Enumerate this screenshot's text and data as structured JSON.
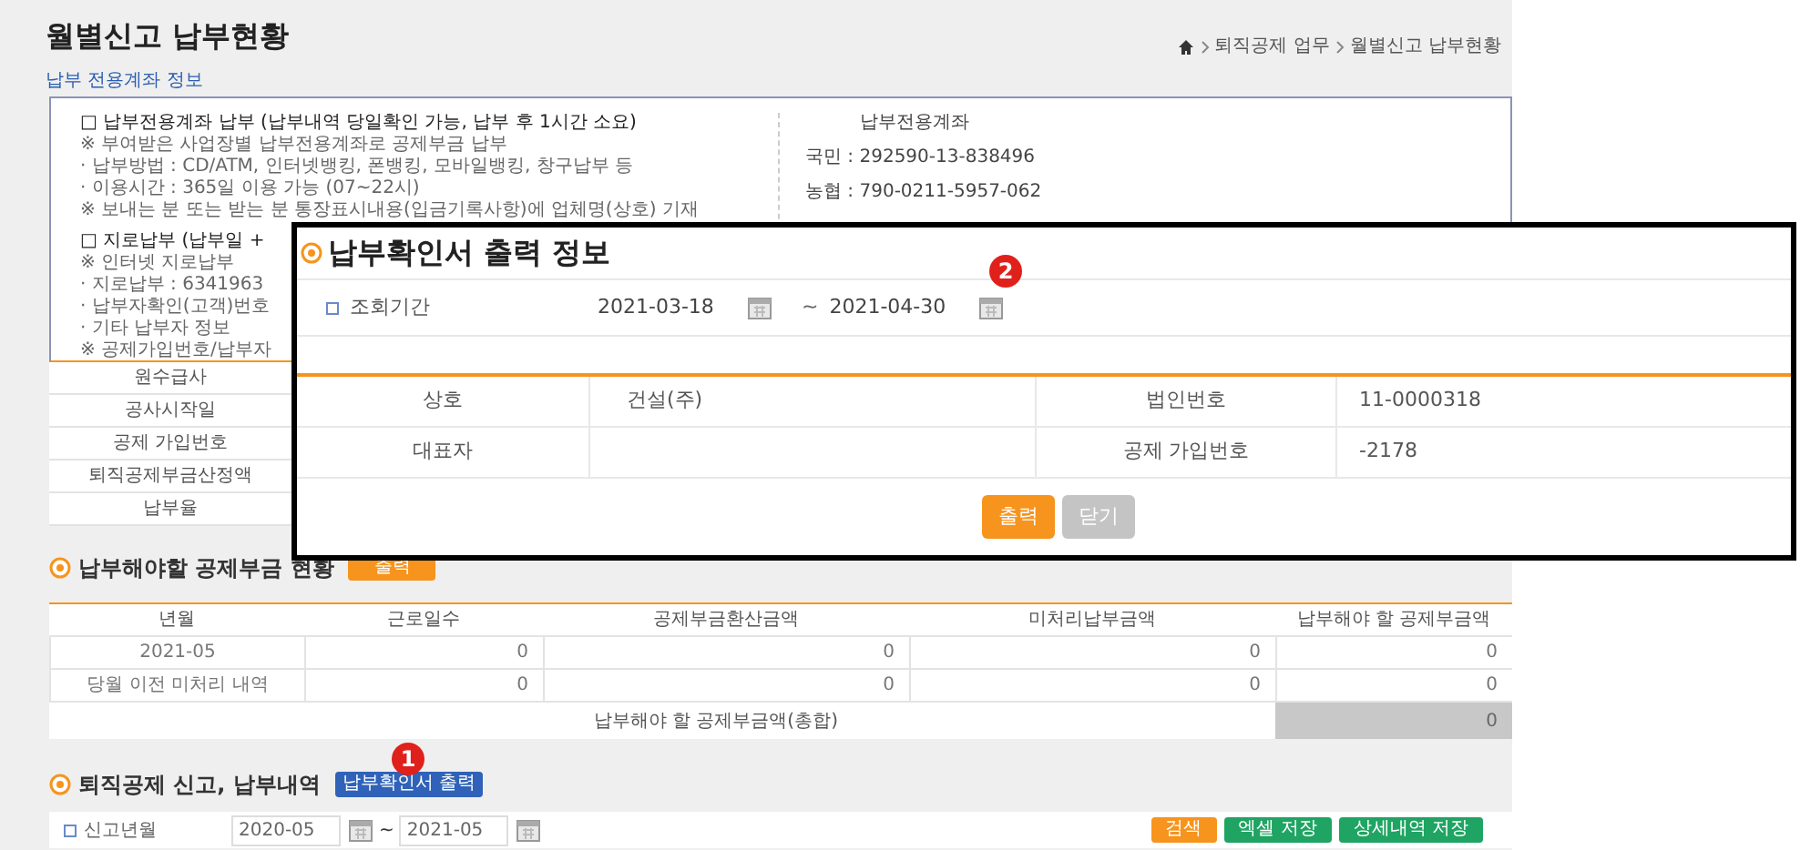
{
  "page_title": "월별신고 납부현황",
  "breadcrumb": [
    "퇴직공제 업무",
    "월별신고 납부현황"
  ],
  "account_info": {
    "title": "납부 전용계좌 정보",
    "left_lines": [
      {
        "kind": "heading",
        "text": "□ 납부전용계좌 납부 (납부내역 당일확인 가능, 납부 후 1시간 소요)"
      },
      {
        "kind": "line",
        "text": "※ 부여받은 사업장별 납부전용계좌로 공제부금 납부"
      },
      {
        "kind": "line",
        "text": "· 납부방법 : CD/ATM, 인터넷뱅킹, 폰뱅킹, 모바일뱅킹, 창구납부 등"
      },
      {
        "kind": "line",
        "text": "· 이용시간 : 365일 이용 가능 (07~22시)"
      },
      {
        "kind": "line",
        "text": "※ 보내는 분 또는 받는 분 통장표시내용(입금기록사항)에 업체명(상호) 기재"
      },
      {
        "kind": "heading",
        "text": "□ 지로납부 (납부일 +"
      },
      {
        "kind": "line",
        "text": "※ 인터넷 지로납부"
      },
      {
        "kind": "line",
        "text": "· 지로납부 : 6341963"
      },
      {
        "kind": "line",
        "text": "· 납부자확인(고객)번호"
      },
      {
        "kind": "line",
        "text": "· 기타 납부자 정보"
      },
      {
        "kind": "line",
        "text": "※ 공제가입번호/납부자"
      }
    ],
    "accounts_title": "납부전용계좌",
    "accounts": [
      "국민 : 292590-13-838496",
      "농협 : 790-0211-5957-062"
    ]
  },
  "detail_rows": [
    "원수급사",
    "공사시작일",
    "공제 가입번호",
    "퇴직공제부금산정액",
    "납부율"
  ],
  "due_section": {
    "title": "납부해야할 공제부금 현황",
    "button": "출력",
    "columns": [
      "년월",
      "근로일수",
      "공제부금환산금액",
      "미처리납부금액",
      "납부해야 할 공제부금액"
    ],
    "rows": [
      [
        "2021-05",
        "0",
        "0",
        "0",
        "0"
      ],
      [
        "당월 이전 미처리 내역",
        "0",
        "0",
        "0",
        "0"
      ]
    ],
    "total_label": "납부해야 할 공제부금액(총합)",
    "total_value": "0"
  },
  "history_section": {
    "title": "퇴직공제 신고, 납부내역",
    "button": "납부확인서 출력",
    "marker": "1",
    "filter_label": "신고년월",
    "from": "2020-05",
    "to": "2021-05",
    "separator": "~",
    "buttons": [
      {
        "label": "검색",
        "kind": "search"
      },
      {
        "label": "엑셀 저장",
        "kind": "save"
      },
      {
        "label": "상세내역 저장",
        "kind": "save"
      }
    ]
  },
  "dialog": {
    "title": "납부확인서 출력 정보",
    "period_label": "조회기간",
    "from": "2021-03-18",
    "to": "2021-04-30",
    "separator": "~",
    "marker": "2",
    "rows": [
      [
        "상호",
        "건설(주)",
        "법인번호",
        "11-0000318"
      ],
      [
        "대표자",
        "",
        "공제 가입번호",
        "-2178"
      ]
    ],
    "buttons": [
      {
        "label": "출력",
        "kind": "primary"
      },
      {
        "label": "닫기",
        "kind": "secondary"
      }
    ]
  }
}
